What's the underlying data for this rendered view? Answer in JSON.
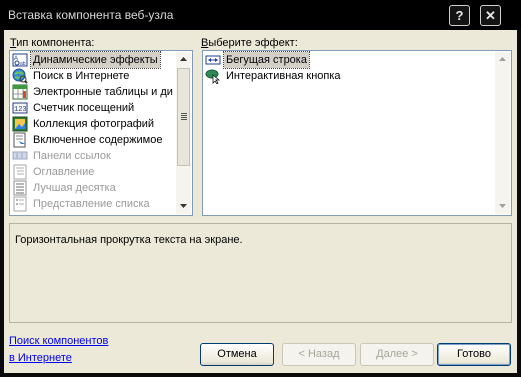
{
  "window": {
    "title": "Вставка компонента веб-узла",
    "help_glyph": "?",
    "close_glyph": "✕"
  },
  "left_list": {
    "label_accel": "Т",
    "label_rest": "ип компонента:",
    "items": [
      {
        "label": "Динамические эффекты",
        "icon": "dynamic-effects-icon",
        "selected": true,
        "disabled": false
      },
      {
        "label": "Поиск в Интернете",
        "icon": "web-search-icon",
        "selected": false,
        "disabled": false
      },
      {
        "label": "Электронные таблицы и ди",
        "icon": "spreadsheet-icon",
        "selected": false,
        "disabled": false
      },
      {
        "label": "Счетчик посещений",
        "icon": "hit-counter-icon",
        "selected": false,
        "disabled": false
      },
      {
        "label": "Коллекция фотографий",
        "icon": "photo-gallery-icon",
        "selected": false,
        "disabled": false
      },
      {
        "label": "Включенное содержимое",
        "icon": "included-content-icon",
        "selected": false,
        "disabled": false
      },
      {
        "label": "Панели ссылок",
        "icon": "link-bar-icon",
        "selected": false,
        "disabled": true
      },
      {
        "label": "Оглавление",
        "icon": "table-of-contents-icon",
        "selected": false,
        "disabled": true
      },
      {
        "label": "Лучшая десятка",
        "icon": "top-ten-icon",
        "selected": false,
        "disabled": true
      },
      {
        "label": "Представление списка",
        "icon": "list-view-icon",
        "selected": false,
        "disabled": true
      }
    ],
    "scroll_position": 0.0
  },
  "right_list": {
    "label_accel": "В",
    "label_rest": "ыберите эффект:",
    "items": [
      {
        "label": "Бегущая строка",
        "icon": "marquee-icon",
        "selected": true
      },
      {
        "label": "Интерактивная кнопка",
        "icon": "interactive-button-icon",
        "selected": false
      }
    ]
  },
  "description": {
    "text": "Горизонтальная прокрутка текста на экране."
  },
  "find_link": {
    "line1": "Поиск компонентов",
    "line2": "в Интернете"
  },
  "buttons": {
    "cancel": "Отмена",
    "back": "< Назад",
    "next": "Далее >",
    "finish": "Готово"
  },
  "colors": {
    "titlebar": "#000000",
    "dialog_bg": "#ece9d8",
    "link": "#0000ee",
    "list_border": "#7f9db9"
  }
}
